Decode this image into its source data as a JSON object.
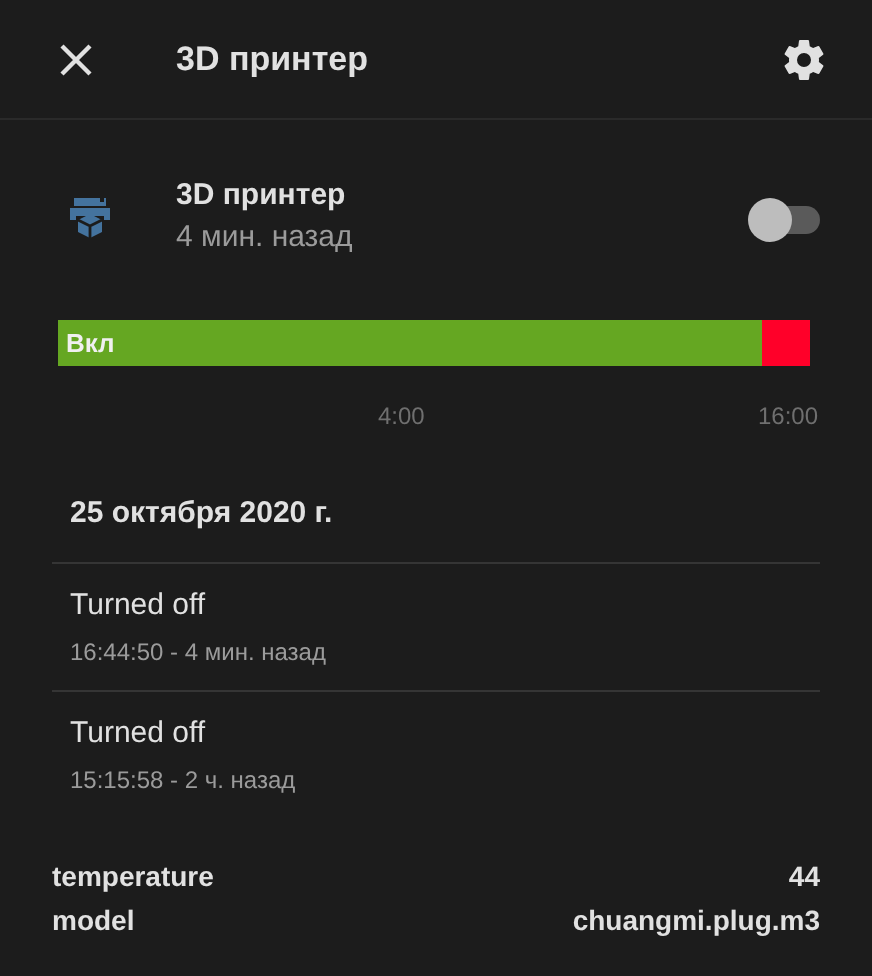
{
  "dialog": {
    "title": "3D принтер"
  },
  "entity": {
    "name": "3D принтер",
    "last_changed": "4 мин. назад",
    "on": false
  },
  "timeline": {
    "level": 0.935,
    "segments": [
      {
        "label": "Вкл",
        "color": "#65a722"
      },
      {
        "color": "#ff0029"
      }
    ],
    "ticks": [
      "4:00",
      "16:00"
    ]
  },
  "logbook": {
    "date": "25 октября 2020 г.",
    "entries": [
      {
        "message": "Turned off",
        "time": "16:44:50 - 4 мин. назад"
      },
      {
        "message": "Turned off",
        "time": "15:15:58 - 2 ч. назад"
      }
    ]
  },
  "attributes": [
    {
      "name": "temperature",
      "value": "44"
    },
    {
      "name": "model",
      "value": "chuangmi.plug.m3"
    }
  ]
}
